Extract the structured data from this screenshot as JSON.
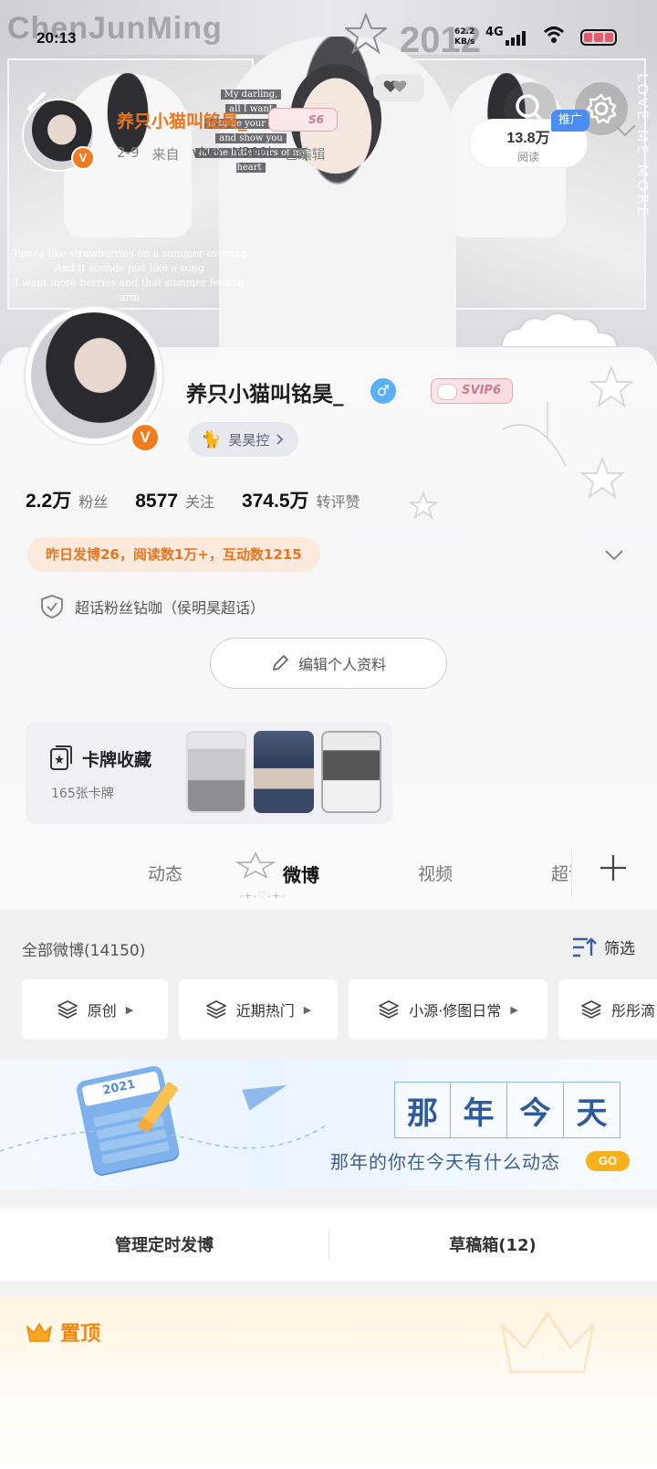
{
  "status_bar": {
    "time": "20:13",
    "net_speed": "62.2",
    "net_unit": "KB/s",
    "network": "4G"
  },
  "banner": {
    "watermark_name": "ChenJunMing",
    "watermark_year": "2012",
    "quote_lines": [
      "My darling,",
      "all I want",
      "is to be your moon",
      "and show you",
      "all the little stars of my heart"
    ],
    "lyric_lines": [
      "Tastes like strawberries on a summer evening",
      "And it sounds just like a song",
      "I want more berries and that summer feeling",
      "arm"
    ],
    "vertical_text": "LOVE ME MORE"
  },
  "profile": {
    "username": "养只小猫叫铭昊_",
    "vip_badge": "SVIP6",
    "group_tag": "昊昊控",
    "stats": [
      {
        "value": "2.2万",
        "label": "粉丝"
      },
      {
        "value": "8577",
        "label": "关注"
      },
      {
        "value": "374.5万",
        "label": "转评赞"
      }
    ],
    "yesterday_summary": "昨日发博26，阅读数1万+，互动数1215",
    "fan_badge": "超话粉丝钻咖（侯明昊超话）",
    "edit_button": "编辑个人资料"
  },
  "card_collection": {
    "title": "卡牌收藏",
    "count": "165张卡牌"
  },
  "tabs": {
    "items": [
      "动态",
      "微博",
      "视频",
      "超话"
    ],
    "active": "微博"
  },
  "filter": {
    "all_label": "全部微博(14150)",
    "filter_button": "筛选",
    "chips": [
      "原创",
      "近期热门",
      "小源·修图日常",
      "彤彤滴"
    ]
  },
  "memory_banner": {
    "calendar_year": "2021",
    "title_chars": [
      "那",
      "年",
      "今",
      "天"
    ],
    "subtitle": "那年的你在今天有什么动态",
    "go_label": "GO"
  },
  "manage": {
    "scheduled": "管理定时发博",
    "drafts": "草稿箱(12)"
  },
  "pinned": {
    "title": "置顶",
    "author": "养只小猫叫铭昊_",
    "author_badge": "S6",
    "date": "2-9",
    "from_label": "来自",
    "device_brand": "vivo",
    "device_model": "Y300i",
    "edited": "已编辑",
    "reads_value": "13.8万",
    "reads_label": "阅读",
    "promo_label": "推广"
  }
}
